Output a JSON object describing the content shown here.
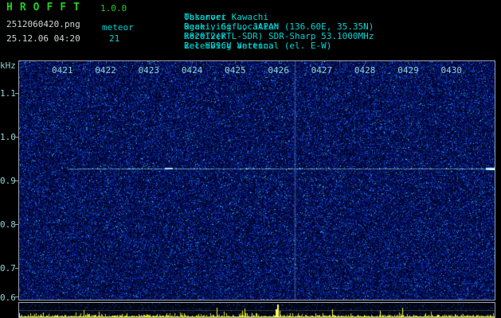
{
  "header": {
    "app_name": "HROFFT",
    "version": "1.0.0",
    "filename": "2512060420.png",
    "mode": "meteor",
    "datetime": "25.12.06 04:20",
    "count": "21",
    "separator": ":",
    "info": [
      {
        "label": "Observer",
        "value": "Takanori Kawachi"
      },
      {
        "label": "Receiving Location",
        "value": "Ogaki, Gifu, JAPAN (136.60E, 35.35N)"
      },
      {
        "label": "Receiver",
        "value": "R820T2(RTL-SDR) SDR-Sharp 53.1000MHz"
      },
      {
        "label": "Receiving antenna",
        "value": "2el-HB9CV Vertical (el. E-W)"
      }
    ]
  },
  "colors": {
    "title_green": "#22cc22",
    "text_cyan": "#00d4d4",
    "text_white": "#ccd6d6",
    "axis_text": "#8fd2d2",
    "plot_border": "#98a0b0",
    "noise_base_blue": "#000a30",
    "carrier_cyan": "#96f0f0",
    "spike_yellow": "#e8e800"
  },
  "chart_data": {
    "type": "heatmap",
    "x_tick_labels": [
      "0421",
      "0422",
      "0423",
      "0424",
      "0425",
      "0426",
      "0427",
      "0428",
      "0429",
      "0430"
    ],
    "x_span_time": [
      "04:20",
      "04:31"
    ],
    "y_axis_unit": "kHz",
    "y_tick_labels": [
      "1.1",
      "1.0",
      "0.9",
      "0.8",
      "0.7",
      "0.6"
    ],
    "y_range_khz": [
      0.63,
      1.17
    ],
    "carrier_line_khz": 0.93,
    "vertical_event_time": "04:26",
    "bottom_strip": {
      "content": "received signal level vs time, yellow noise spikes over blue noise floor",
      "big_spike_time": "04:26"
    },
    "seed": 2512060420
  }
}
